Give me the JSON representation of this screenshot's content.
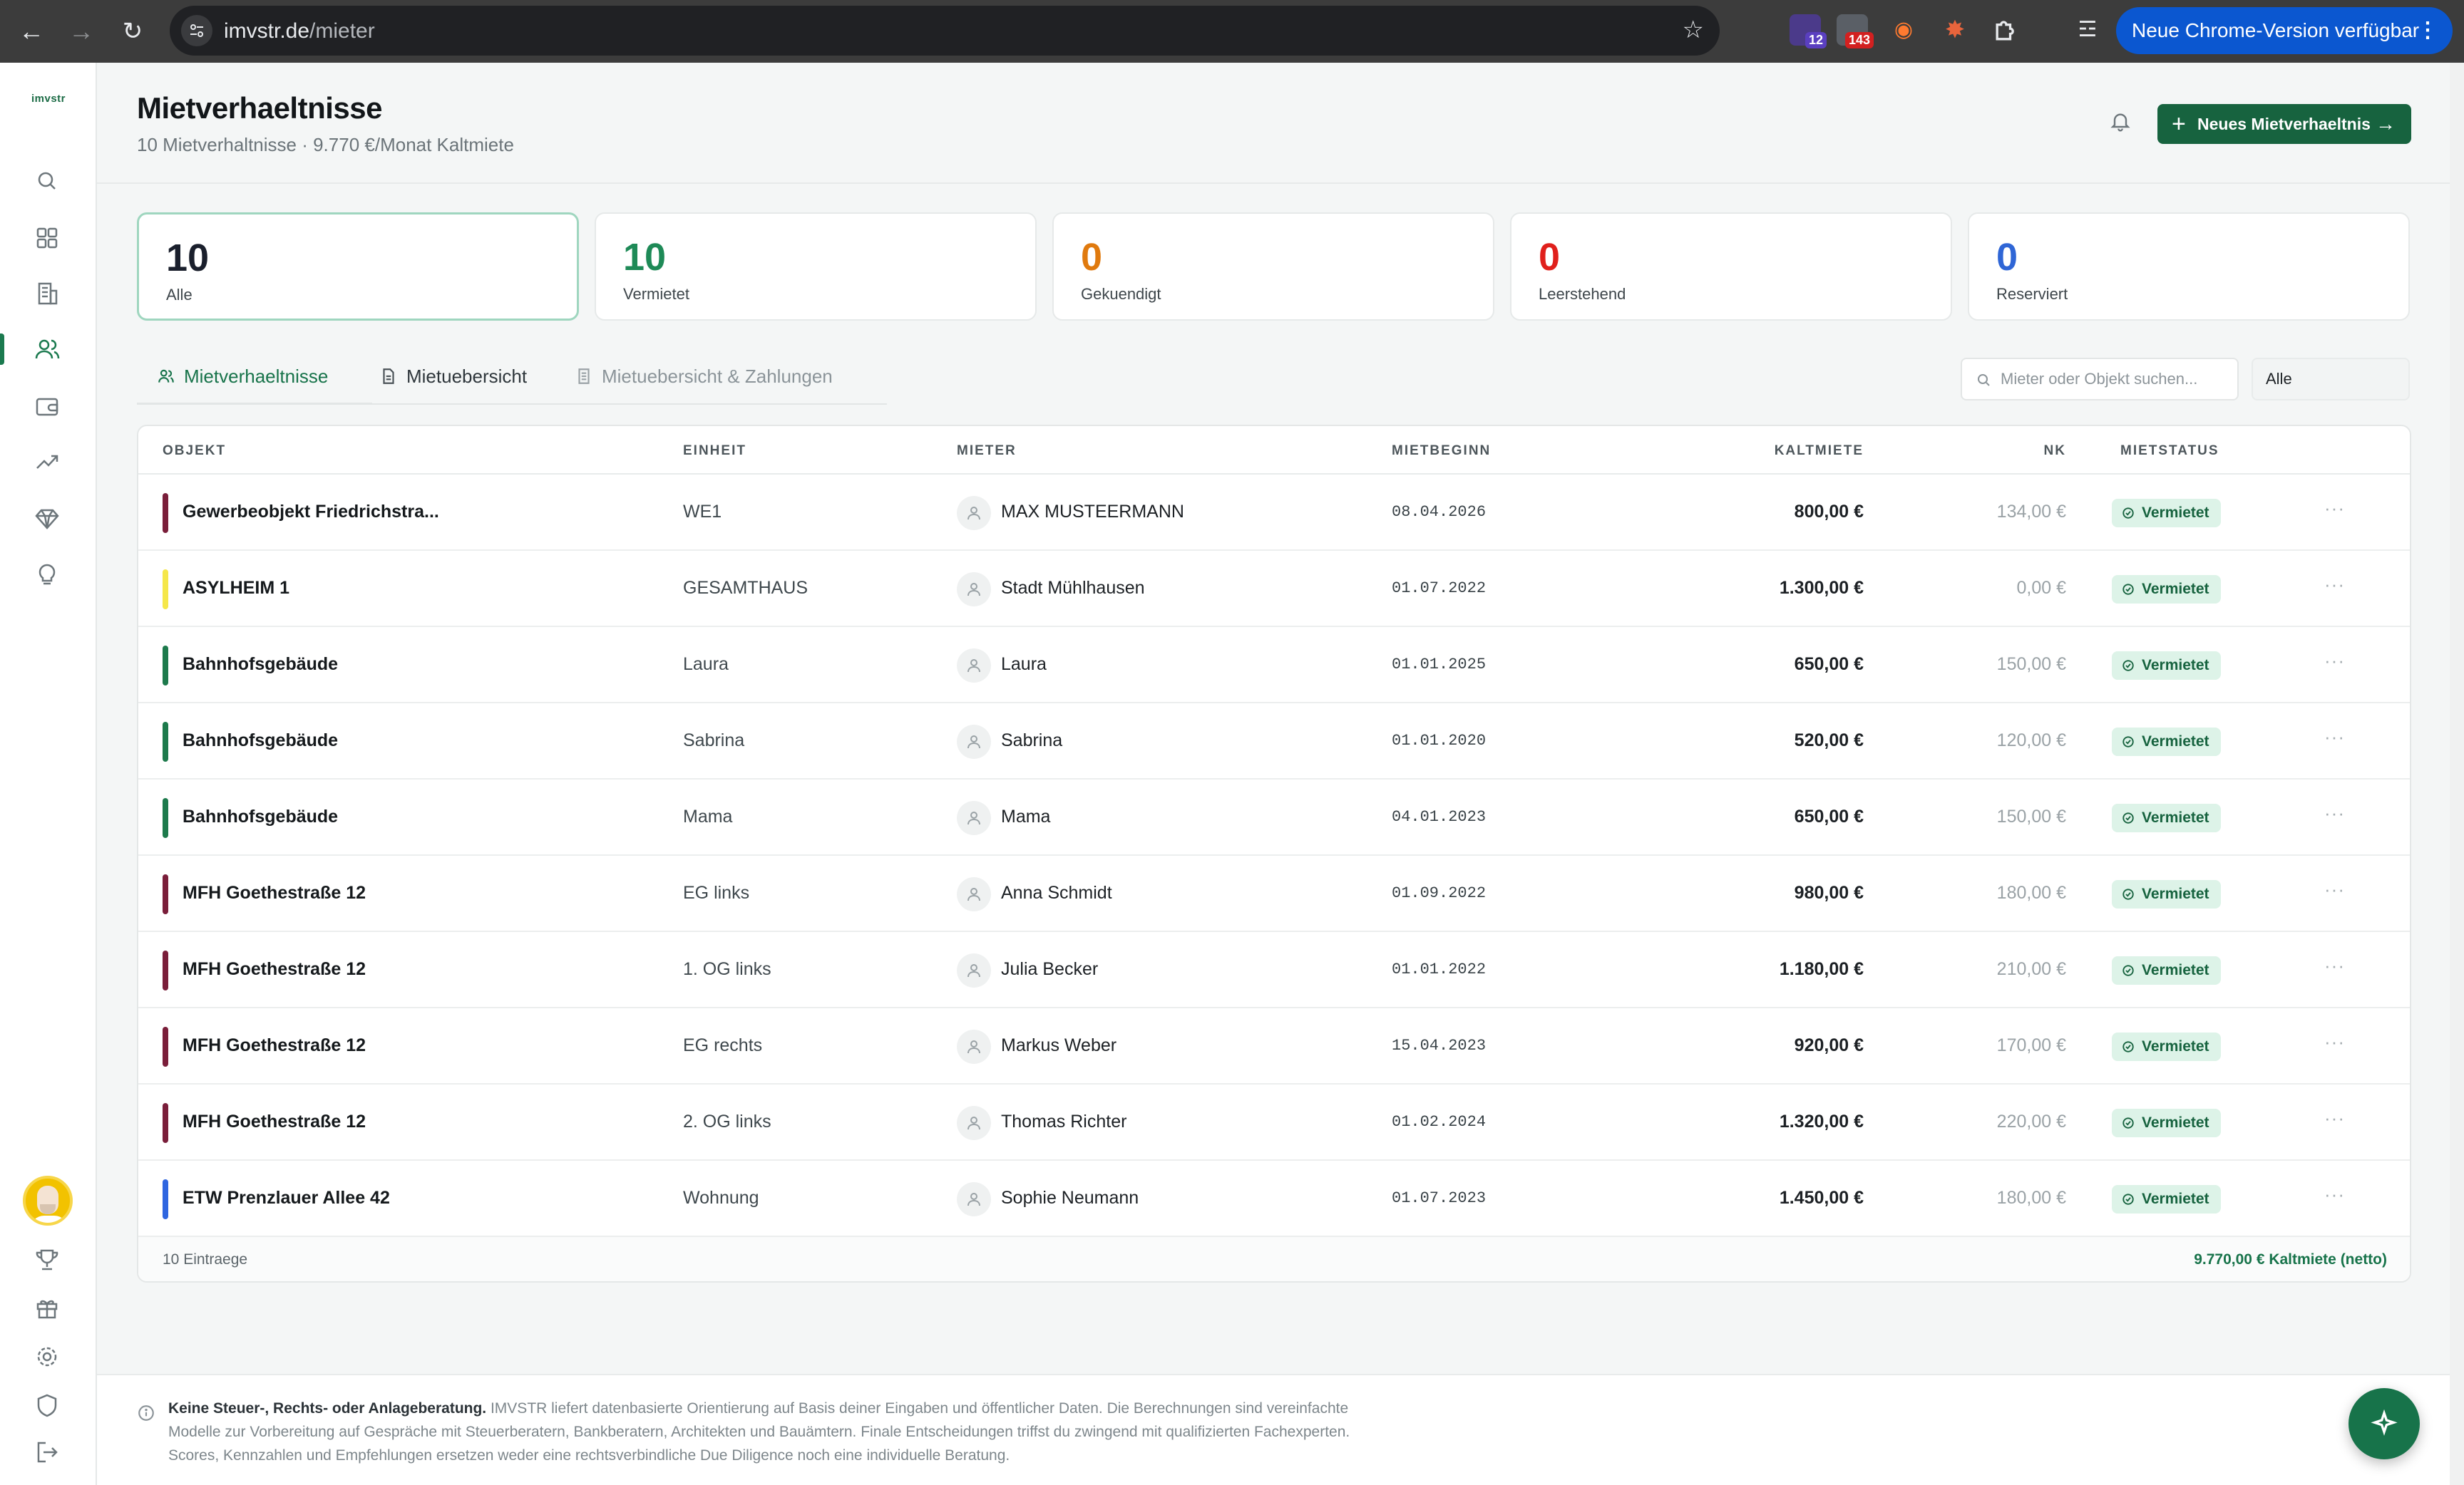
{
  "browser": {
    "url_host": "imvstr.de",
    "url_path": "/mieter",
    "ext_badge_1": "12",
    "ext_badge_2": "143",
    "update_label": "Neue Chrome-Version verfügbar"
  },
  "sidebar": {
    "brand": "imvstr",
    "items": [
      "search-icon",
      "dashboard-icon",
      "buildings-icon",
      "tenants-icon",
      "wallet-icon",
      "trend-icon",
      "diamond-icon",
      "lightbulb-icon"
    ],
    "bottom_items": [
      "trophy-icon",
      "gift-icon",
      "gear-icon",
      "shield-icon",
      "logout-icon"
    ],
    "active": "tenants-icon"
  },
  "header": {
    "title": "Mietverhaeltnisse",
    "subtitle": "10 Mietverhaltnisse · 9.770 €/Monat Kaltmiete",
    "new_button": "Neues Mietverhaeltnis"
  },
  "stats": [
    {
      "value": "10",
      "label": "Alle",
      "color": "#1a1f2c"
    },
    {
      "value": "10",
      "label": "Vermietet",
      "color": "#1e8a57"
    },
    {
      "value": "0",
      "label": "Gekuendigt",
      "color": "#e07a0e"
    },
    {
      "value": "0",
      "label": "Leerstehend",
      "color": "#e0201c"
    },
    {
      "value": "0",
      "label": "Reserviert",
      "color": "#2f66d6"
    }
  ],
  "tabs": [
    {
      "label": "Mietverhaeltnisse",
      "state": "active"
    },
    {
      "label": "Mietuebersicht",
      "state": "normal"
    },
    {
      "label": "Mietuebersicht & Zahlungen",
      "state": "muted"
    }
  ],
  "search": {
    "placeholder": "Mieter oder Objekt suchen..."
  },
  "filter": {
    "selected": "Alle"
  },
  "table": {
    "columns": [
      "OBJEKT",
      "EINHEIT",
      "MIETER",
      "MIETBEGINN",
      "KALTMIETE",
      "NK",
      "MIETSTATUS"
    ],
    "rows": [
      {
        "objekt": "Gewerbeobjekt Friedrichstra...",
        "einheit": "WE1",
        "mieter": "MAX MUSTEERMANN",
        "beginn": "08.04.2026",
        "kalt": "800,00 €",
        "nk": "134,00 €",
        "status": "Vermietet",
        "color": "#7a1e3a"
      },
      {
        "objekt": "ASYLHEIM 1",
        "einheit": "GESAMTHAUS",
        "mieter": "Stadt Mühlhausen",
        "beginn": "01.07.2022",
        "kalt": "1.300,00 €",
        "nk": "0,00 €",
        "status": "Vermietet",
        "color": "#f5e74a"
      },
      {
        "objekt": "Bahnhofsgebäude",
        "einheit": "Laura",
        "mieter": "Laura",
        "beginn": "01.01.2025",
        "kalt": "650,00 €",
        "nk": "150,00 €",
        "status": "Vermietet",
        "color": "#1d7a4c"
      },
      {
        "objekt": "Bahnhofsgebäude",
        "einheit": "Sabrina",
        "mieter": "Sabrina",
        "beginn": "01.01.2020",
        "kalt": "520,00 €",
        "nk": "120,00 €",
        "status": "Vermietet",
        "color": "#1d7a4c"
      },
      {
        "objekt": "Bahnhofsgebäude",
        "einheit": "Mama",
        "mieter": "Mama",
        "beginn": "04.01.2023",
        "kalt": "650,00 €",
        "nk": "150,00 €",
        "status": "Vermietet",
        "color": "#1d7a4c"
      },
      {
        "objekt": "MFH Goethestraße 12",
        "einheit": "EG links",
        "mieter": "Anna Schmidt",
        "beginn": "01.09.2022",
        "kalt": "980,00 €",
        "nk": "180,00 €",
        "status": "Vermietet",
        "color": "#7a1e3a"
      },
      {
        "objekt": "MFH Goethestraße 12",
        "einheit": "1. OG links",
        "mieter": "Julia Becker",
        "beginn": "01.01.2022",
        "kalt": "1.180,00 €",
        "nk": "210,00 €",
        "status": "Vermietet",
        "color": "#7a1e3a"
      },
      {
        "objekt": "MFH Goethestraße 12",
        "einheit": "EG rechts",
        "mieter": "Markus Weber",
        "beginn": "15.04.2023",
        "kalt": "920,00 €",
        "nk": "170,00 €",
        "status": "Vermietet",
        "color": "#7a1e3a"
      },
      {
        "objekt": "MFH Goethestraße 12",
        "einheit": "2. OG links",
        "mieter": "Thomas Richter",
        "beginn": "01.02.2024",
        "kalt": "1.320,00 €",
        "nk": "220,00 €",
        "status": "Vermietet",
        "color": "#7a1e3a"
      },
      {
        "objekt": "ETW Prenzlauer Allee 42",
        "einheit": "Wohnung",
        "mieter": "Sophie Neumann",
        "beginn": "01.07.2023",
        "kalt": "1.450,00 €",
        "nk": "180,00 €",
        "status": "Vermietet",
        "color": "#2f66e0"
      }
    ],
    "footer_count": "10 Eintraege",
    "footer_total": "9.770,00 € Kaltmiete (netto)"
  },
  "disclaimer": {
    "bold": "Keine Steuer-, Rechts- oder Anlageberatung.",
    "text": " IMVSTR liefert datenbasierte Orientierung auf Basis deiner Eingaben und öffentlicher Daten. Die Berechnungen sind vereinfachte Modelle zur Vorbereitung auf Gespräche mit Steuerberatern, Bankberatern, Architekten und Bauämtern. Finale Entscheidungen triffst du zwingend mit qualifizierten Fachexperten. Scores, Kennzahlen und Empfehlungen ersetzen weder eine rechtsverbindliche Due Diligence noch eine individuelle Beratung."
  }
}
